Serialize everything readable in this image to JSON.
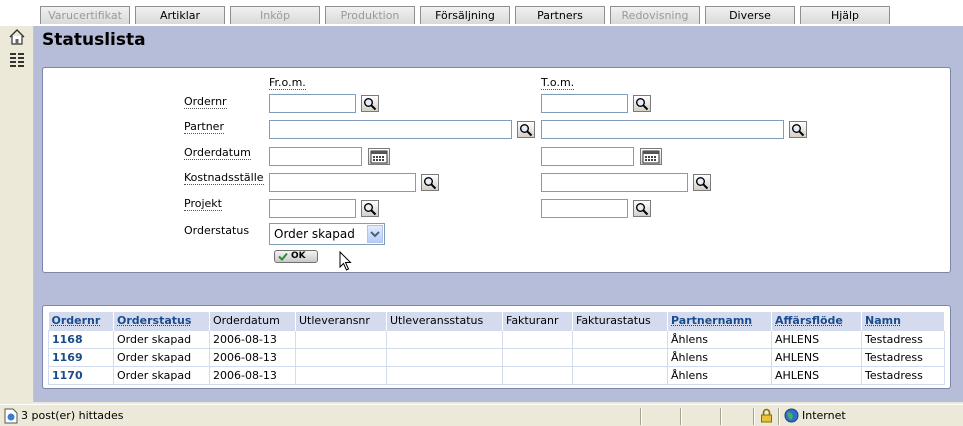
{
  "menu": {
    "tabs": [
      {
        "label": "Varucertifikat",
        "disabled": true
      },
      {
        "label": "Artiklar",
        "disabled": false
      },
      {
        "label": "Inköp",
        "disabled": true
      },
      {
        "label": "Produktion",
        "disabled": true
      },
      {
        "label": "Försäljning",
        "disabled": false
      },
      {
        "label": "Partners",
        "disabled": false
      },
      {
        "label": "Redovisning",
        "disabled": true
      },
      {
        "label": "Diverse",
        "disabled": false
      },
      {
        "label": "Hjälp",
        "disabled": false
      }
    ]
  },
  "sidebar": {
    "icons": [
      "home-icon",
      "list-icon"
    ]
  },
  "page": {
    "title": "Statuslista"
  },
  "form": {
    "from_label": "Fr.o.m.",
    "to_label": "T.o.m.",
    "fields": {
      "ordernr": {
        "label": "Ordernr",
        "from": "",
        "to": ""
      },
      "partner": {
        "label": "Partner",
        "from": "",
        "to": ""
      },
      "orderdatum": {
        "label": "Orderdatum",
        "from": "",
        "to": ""
      },
      "kostnadsstalle": {
        "label": "Kostnadsställe",
        "from": "",
        "to": ""
      },
      "projekt": {
        "label": "Projekt",
        "from": "",
        "to": ""
      }
    },
    "orderstatus": {
      "label": "Orderstatus",
      "value": "Order skapad"
    },
    "ok_label": "OK"
  },
  "results": {
    "columns": [
      "Ordernr",
      "Orderstatus",
      "Orderdatum",
      "Utleveransnr",
      "Utleveransstatus",
      "Fakturanr",
      "Fakturastatus",
      "Partnernamn",
      "Affärsflöde",
      "Namn"
    ],
    "rows": [
      {
        "ordernr": "1168",
        "orderstatus": "Order skapad",
        "orderdatum": "2006-08-13",
        "utleveransnr": "",
        "utleveransstatus": "",
        "fakturanr": "",
        "fakturastatus": "",
        "partnernamn": "Åhlens",
        "affarsflode": "AHLENS",
        "namn": "Testadress"
      },
      {
        "ordernr": "1169",
        "orderstatus": "Order skapad",
        "orderdatum": "2006-08-13",
        "utleveransnr": "",
        "utleveransstatus": "",
        "fakturanr": "",
        "fakturastatus": "",
        "partnernamn": "Åhlens",
        "affarsflode": "AHLENS",
        "namn": "Testadress"
      },
      {
        "ordernr": "1170",
        "orderstatus": "Order skapad",
        "orderdatum": "2006-08-13",
        "utleveransnr": "",
        "utleveransstatus": "",
        "fakturanr": "",
        "fakturastatus": "",
        "partnernamn": "Åhlens",
        "affarsflode": "AHLENS",
        "namn": "Testadress"
      }
    ]
  },
  "statusbar": {
    "message": "3 post(er) hittades",
    "zone": "Internet"
  },
  "colors": {
    "main_bg": "#b5bdd8",
    "header_bg": "#d5dbef",
    "link": "#1a4b8c"
  }
}
